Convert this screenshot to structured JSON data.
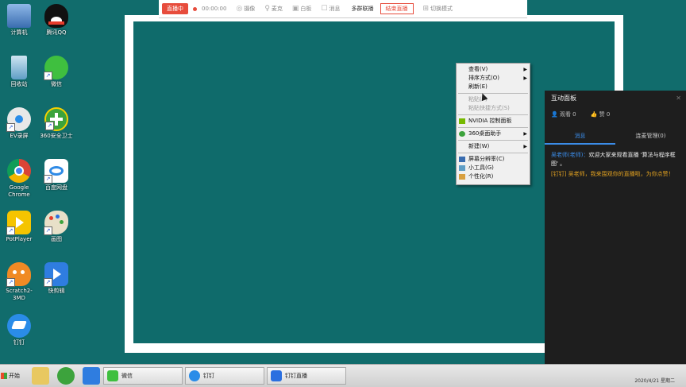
{
  "desktop_icons": [
    {
      "label": "计算机",
      "icon": "computer-icon",
      "color": "#4a7fc0"
    },
    {
      "label": "腾讯QQ",
      "icon": "qq-penguin-icon",
      "color": "#111111"
    },
    {
      "label": "回收站",
      "icon": "recycle-bin-icon",
      "color": "#6fa8c8"
    },
    {
      "label": "微信",
      "icon": "wechat-icon",
      "color": "#3fbf3f"
    },
    {
      "label": "EV录屏",
      "icon": "ev-recorder-icon",
      "color": "#e8e8e8"
    },
    {
      "label": "360安全卫士",
      "icon": "360-security-icon",
      "color": "#3ca33c"
    },
    {
      "label": "Google Chrome",
      "icon": "chrome-icon",
      "color": "#db4437"
    },
    {
      "label": "百度网盘",
      "icon": "baidu-netdisk-icon",
      "color": "#2f8be6"
    },
    {
      "label": "PotPlayer",
      "icon": "potplayer-icon",
      "color": "#f5c400"
    },
    {
      "label": "画图",
      "icon": "paint-palette-icon",
      "color": "#e8e0c8"
    },
    {
      "label": "Scratch2-3MD",
      "icon": "scratch-cat-icon",
      "color": "#f08a24"
    },
    {
      "label": "快剪辑",
      "icon": "kuaijianji-icon",
      "color": "#2f7de0"
    },
    {
      "label": "钉钉",
      "icon": "dingtalk-icon",
      "color": "#2a8ce8"
    }
  ],
  "toolbar": {
    "recording_label": "直播中",
    "timer": "00:00:00",
    "items": [
      {
        "label": "摄像",
        "icon": "camera-icon"
      },
      {
        "label": "麦克",
        "icon": "microphone-icon"
      },
      {
        "label": "白板",
        "icon": "whiteboard-icon"
      },
      {
        "label": "消息",
        "icon": "message-icon"
      }
    ],
    "multi_live_label": "多群联播",
    "end_live_label": "结束直播",
    "switch_mode_label": "切换模式"
  },
  "context_menu": {
    "items": [
      {
        "label": "查看(V)",
        "type": "submenu"
      },
      {
        "label": "排序方式(O)",
        "type": "submenu"
      },
      {
        "label": "刷新(E)",
        "type": "item"
      },
      {
        "type": "separator"
      },
      {
        "label": "粘贴(P)",
        "type": "disabled"
      },
      {
        "label": "粘贴快捷方式(S)",
        "type": "disabled"
      },
      {
        "type": "separator"
      },
      {
        "label": "NVIDIA 控制面板",
        "type": "item",
        "icon": "nvidia-icon"
      },
      {
        "type": "separator"
      },
      {
        "label": "360桌面助手",
        "type": "submenu",
        "icon": "360-desktop-icon"
      },
      {
        "type": "separator"
      },
      {
        "label": "新建(W)",
        "type": "submenu"
      },
      {
        "type": "separator"
      },
      {
        "label": "屏幕分辨率(C)",
        "type": "item",
        "icon": "display-icon"
      },
      {
        "label": "小工具(G)",
        "type": "item",
        "icon": "gadget-icon"
      },
      {
        "label": "个性化(R)",
        "type": "item",
        "icon": "personalize-icon"
      }
    ]
  },
  "panel": {
    "title": "互动面板",
    "viewers_label": "观看 0",
    "likes_label": "赞 0",
    "tabs": [
      {
        "label": "消息",
        "active": true
      },
      {
        "label": "连麦管理(0)",
        "active": false
      }
    ],
    "messages": [
      {
        "user": "吴老师(老师)：",
        "text": "欢迎大家来观看直播 '算法与程序框图' 。",
        "style": "normal"
      },
      {
        "text": "[钉钉] 吴老师，我来围观你的直播啦，为你点赞！",
        "style": "highlight"
      }
    ]
  },
  "taskbar": {
    "start_label": "开始",
    "buttons": [
      {
        "label": "微信",
        "icon": "wechat-icon",
        "color": "#3fbf3f"
      },
      {
        "label": "钉钉",
        "icon": "dingtalk-icon",
        "color": "#2a8ce8"
      },
      {
        "label": "钉钉直播",
        "icon": "dingtalk-live-icon",
        "color": "#2a6fe0"
      }
    ],
    "clock": "2020/4/21 星期二"
  }
}
